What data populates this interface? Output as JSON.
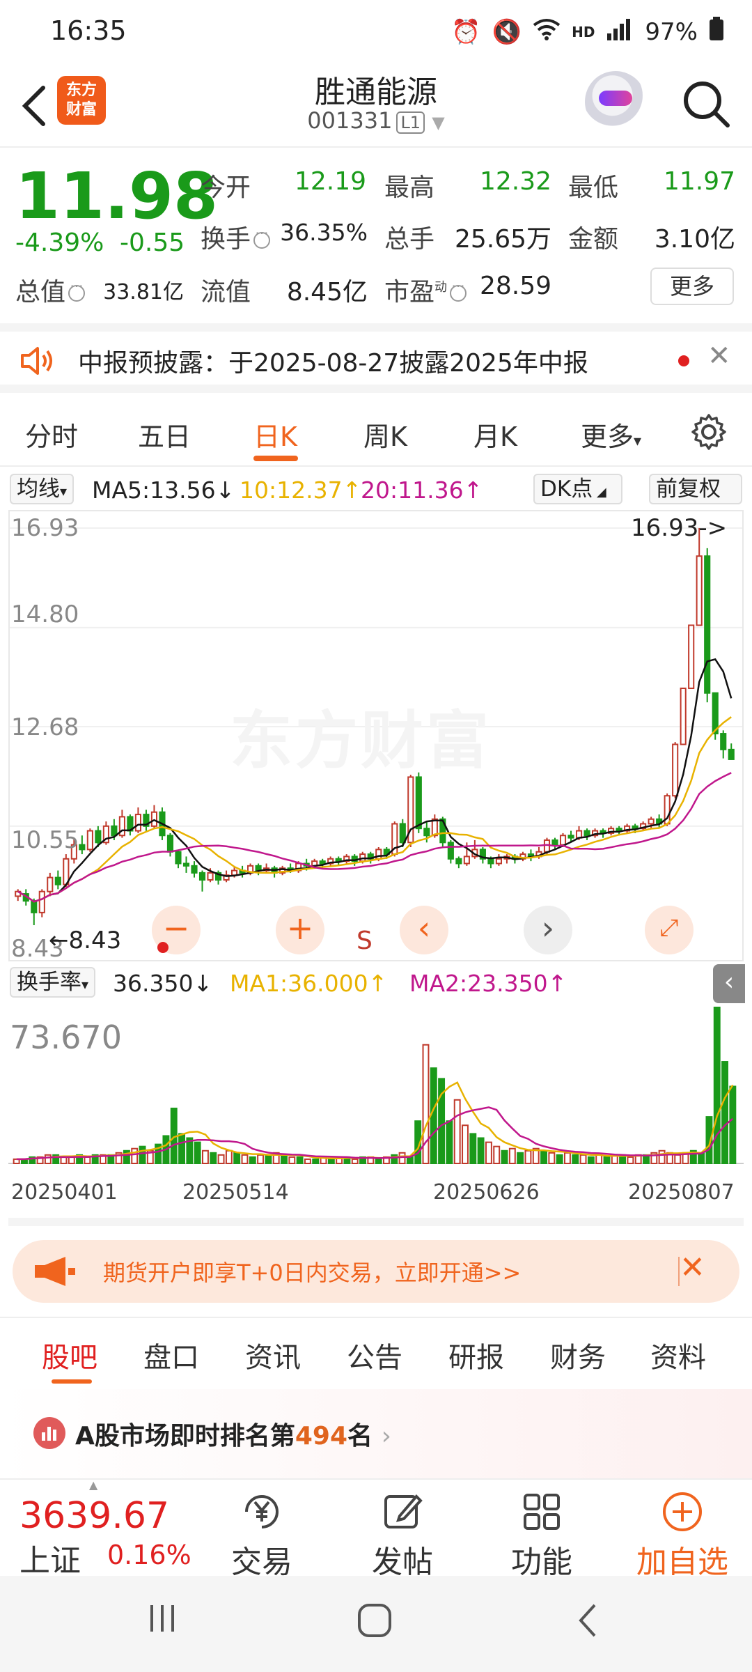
{
  "status": {
    "time": "16:35",
    "battery": "97%",
    "net": "4G",
    "hd": "HD"
  },
  "header": {
    "name": "胜通能源",
    "code": "001331",
    "level": "L1",
    "logo_line1": "东方",
    "logo_line2": "财富"
  },
  "quote": {
    "price": "11.98",
    "pct": "-4.39%",
    "chg": "-0.55",
    "open_label": "今开",
    "open": "12.19",
    "high_label": "最高",
    "high": "12.32",
    "low_label": "最低",
    "low": "11.97",
    "turnover_label": "换手",
    "turnover": "36.35%",
    "volume_label": "总手",
    "volume": "25.65万",
    "amount_label": "金额",
    "amount": "3.10亿",
    "mktcap_label": "总值",
    "mktcap": "33.81亿",
    "float_label": "流值",
    "float": "8.45亿",
    "pe_label": "市盈",
    "pe_sup": "动",
    "pe": "28.59",
    "more": "更多"
  },
  "announcement": {
    "text": "中报预披露：于2025-08-27披露2025年中报"
  },
  "period_tabs": [
    "分时",
    "五日",
    "日K",
    "周K",
    "月K",
    "更多"
  ],
  "ma_row": {
    "selector": "均线",
    "ma5": "MA5:13.56",
    "ma10": "10:12.37",
    "ma20": "20:11.36",
    "dk": "DK点",
    "adjust": "前复权"
  },
  "kchart": {
    "y_labels": [
      "16.93",
      "14.80",
      "12.68",
      "10.55",
      "8.43"
    ],
    "max_marker": "16.93->",
    "min_marker": "8.43",
    "watermark": "东方财富",
    "s_marker": "S"
  },
  "vol_row": {
    "selector": "换手率",
    "value": "36.350",
    "ma1": "MA1:36.000",
    "ma2": "MA2:23.350",
    "ymax": "73.670"
  },
  "dates": [
    "20250401",
    "20250514",
    "20250626",
    "20250807"
  ],
  "banner": {
    "text": "期货开户即享T+0日内交易，立即开通>>"
  },
  "info_tabs": [
    "股吧",
    "盘口",
    "资讯",
    "公告",
    "研报",
    "财务",
    "资料"
  ],
  "rank": {
    "prefix": "A股市场即时排名第",
    "num": "494",
    "suffix": "名"
  },
  "bottom": {
    "index_value": "3639.67",
    "index_name": "上证",
    "index_chg": "0.16%",
    "items": [
      "交易",
      "发帖",
      "功能",
      "加自选"
    ]
  },
  "colors": {
    "up": "#c0392b",
    "down": "#1a9a1a",
    "accent": "#f0641e"
  },
  "chart_data": {
    "type": "candlestick",
    "title": "",
    "price_axis": [
      8.43,
      16.93
    ],
    "high_marker": 16.93,
    "low_marker": 8.43,
    "ma_lines": [
      "MA5",
      "MA10",
      "MA20"
    ],
    "ma_latest": {
      "MA5": 13.56,
      "MA10": 12.37,
      "MA20": 11.36
    },
    "candles": [
      [
        9.05,
        9.15,
        8.95,
        9.2
      ],
      [
        9.1,
        8.95,
        8.85,
        9.2
      ],
      [
        8.95,
        8.7,
        8.43,
        9.0
      ],
      [
        8.7,
        9.15,
        8.6,
        9.2
      ],
      [
        9.15,
        9.45,
        9.05,
        9.55
      ],
      [
        9.45,
        9.3,
        9.2,
        9.6
      ],
      [
        9.3,
        9.85,
        9.25,
        9.95
      ],
      [
        9.85,
        10.15,
        9.75,
        10.3
      ],
      [
        10.15,
        10.05,
        9.95,
        10.35
      ],
      [
        10.05,
        10.45,
        10.0,
        10.5
      ],
      [
        10.45,
        10.2,
        10.1,
        10.55
      ],
      [
        10.2,
        10.55,
        10.15,
        10.65
      ],
      [
        10.55,
        10.35,
        10.25,
        10.7
      ],
      [
        10.35,
        10.75,
        10.3,
        10.9
      ],
      [
        10.75,
        10.45,
        10.35,
        10.8
      ],
      [
        10.45,
        10.8,
        10.4,
        10.95
      ],
      [
        10.8,
        10.55,
        10.45,
        10.9
      ],
      [
        10.55,
        10.85,
        10.5,
        11.0
      ],
      [
        10.85,
        10.35,
        10.25,
        10.95
      ],
      [
        10.35,
        10.0,
        9.9,
        10.4
      ],
      [
        10.0,
        9.75,
        9.65,
        10.05
      ],
      [
        9.75,
        9.7,
        9.55,
        9.9
      ],
      [
        9.7,
        9.55,
        9.45,
        9.8
      ],
      [
        9.55,
        9.4,
        9.15,
        9.6
      ],
      [
        9.4,
        9.55,
        9.35,
        9.65
      ],
      [
        9.55,
        9.4,
        9.3,
        9.6
      ],
      [
        9.4,
        9.5,
        9.35,
        9.6
      ],
      [
        9.5,
        9.6,
        9.45,
        9.7
      ],
      [
        9.6,
        9.55,
        9.45,
        9.7
      ],
      [
        9.55,
        9.7,
        9.5,
        9.75
      ],
      [
        9.7,
        9.6,
        9.5,
        9.75
      ],
      [
        9.6,
        9.65,
        9.55,
        9.75
      ],
      [
        9.65,
        9.55,
        9.45,
        9.7
      ],
      [
        9.55,
        9.65,
        9.5,
        9.7
      ],
      [
        9.65,
        9.6,
        9.55,
        9.75
      ],
      [
        9.6,
        9.75,
        9.55,
        9.8
      ],
      [
        9.75,
        9.7,
        9.6,
        9.85
      ],
      [
        9.7,
        9.8,
        9.65,
        9.85
      ],
      [
        9.8,
        9.75,
        9.65,
        9.85
      ],
      [
        9.75,
        9.85,
        9.7,
        9.9
      ],
      [
        9.85,
        9.8,
        9.7,
        9.9
      ],
      [
        9.8,
        9.9,
        9.75,
        9.95
      ],
      [
        9.9,
        9.8,
        9.7,
        9.95
      ],
      [
        9.8,
        9.95,
        9.75,
        10.0
      ],
      [
        9.95,
        9.85,
        9.75,
        10.0
      ],
      [
        9.85,
        10.05,
        9.8,
        10.1
      ],
      [
        10.05,
        9.95,
        9.85,
        10.1
      ],
      [
        9.95,
        10.6,
        9.9,
        10.65
      ],
      [
        10.6,
        10.2,
        10.1,
        10.7
      ],
      [
        10.2,
        11.6,
        10.1,
        11.65
      ],
      [
        11.6,
        10.5,
        10.4,
        11.7
      ],
      [
        10.5,
        10.35,
        10.2,
        10.65
      ],
      [
        10.35,
        10.7,
        10.3,
        10.8
      ],
      [
        10.7,
        10.2,
        10.1,
        10.75
      ],
      [
        10.2,
        9.85,
        9.75,
        10.25
      ],
      [
        9.85,
        9.75,
        9.65,
        9.9
      ],
      [
        9.75,
        9.9,
        9.7,
        10.2
      ],
      [
        9.9,
        10.05,
        9.85,
        10.25
      ],
      [
        10.05,
        9.85,
        9.75,
        10.1
      ],
      [
        9.85,
        9.75,
        9.65,
        9.9
      ],
      [
        9.75,
        9.85,
        9.7,
        9.95
      ],
      [
        9.85,
        9.9,
        9.75,
        9.95
      ],
      [
        9.9,
        9.85,
        9.75,
        9.95
      ],
      [
        9.85,
        9.95,
        9.8,
        10.0
      ],
      [
        9.95,
        9.9,
        9.8,
        10.05
      ],
      [
        9.9,
        10.0,
        9.85,
        10.1
      ],
      [
        10.0,
        10.25,
        9.95,
        10.3
      ],
      [
        10.25,
        10.15,
        10.05,
        10.3
      ],
      [
        10.15,
        10.35,
        10.1,
        10.4
      ],
      [
        10.35,
        10.3,
        10.2,
        10.45
      ],
      [
        10.3,
        10.45,
        10.25,
        10.55
      ],
      [
        10.45,
        10.35,
        10.25,
        10.5
      ],
      [
        10.35,
        10.45,
        10.3,
        10.5
      ],
      [
        10.45,
        10.4,
        10.3,
        10.5
      ],
      [
        10.4,
        10.5,
        10.35,
        10.55
      ],
      [
        10.5,
        10.45,
        10.35,
        10.55
      ],
      [
        10.45,
        10.55,
        10.4,
        10.6
      ],
      [
        10.55,
        10.5,
        10.4,
        10.6
      ],
      [
        10.5,
        10.6,
        10.45,
        10.65
      ],
      [
        10.6,
        10.7,
        10.5,
        10.75
      ],
      [
        10.7,
        10.6,
        10.5,
        10.8
      ],
      [
        10.6,
        11.2,
        10.55,
        11.25
      ],
      [
        11.2,
        12.3,
        11.15,
        12.35
      ],
      [
        12.3,
        13.5,
        12.3,
        13.5
      ],
      [
        13.5,
        14.85,
        13.5,
        14.85
      ],
      [
        14.85,
        16.33,
        14.85,
        16.93
      ],
      [
        16.33,
        13.4,
        13.2,
        16.5
      ],
      [
        13.4,
        12.53,
        12.4,
        13.3
      ],
      [
        12.53,
        12.19,
        12.0,
        12.6
      ],
      [
        12.19,
        11.98,
        11.97,
        12.32
      ]
    ],
    "vol_axis_max": 73.67,
    "turnover": [
      2,
      2,
      3,
      3,
      4,
      4,
      3,
      3,
      4,
      3,
      4,
      4,
      4,
      5,
      6,
      7,
      8,
      6,
      9,
      13,
      26,
      14,
      12,
      10,
      6,
      5,
      4,
      6,
      5,
      4,
      3,
      4,
      4,
      5,
      4,
      3,
      3,
      2,
      2,
      3,
      2,
      3,
      3,
      2,
      3,
      3,
      2,
      3,
      4,
      5,
      3,
      20,
      56,
      45,
      40,
      20,
      30,
      18,
      14,
      12,
      10,
      8,
      6,
      7,
      5,
      6,
      7,
      6,
      5,
      4,
      5,
      4,
      4,
      3,
      4,
      3,
      4,
      4,
      3,
      4,
      4,
      5,
      6,
      5,
      4,
      5,
      6,
      5,
      22,
      73.67,
      48,
      36.35
    ]
  }
}
